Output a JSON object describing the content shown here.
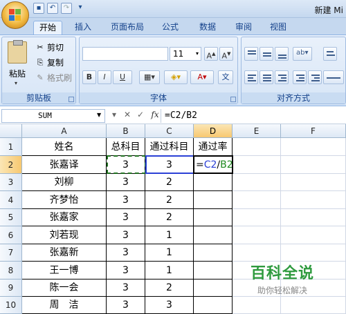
{
  "window": {
    "title": "新建 Mi"
  },
  "quick_access": [
    "save-icon",
    "undo-icon",
    "redo-icon",
    "customize-icon"
  ],
  "tabs": [
    "开始",
    "插入",
    "页面布局",
    "公式",
    "数据",
    "审阅",
    "视图"
  ],
  "ribbon": {
    "clipboard": {
      "label": "剪贴板",
      "paste": "粘贴",
      "cut": "剪切",
      "copy": "复制",
      "format_painter": "格式刷"
    },
    "font": {
      "label": "字体",
      "font_name": "",
      "font_size": "11",
      "bold": "B",
      "italic": "I",
      "underline": "U"
    },
    "alignment": {
      "label": "对齐方式"
    }
  },
  "formula_bar": {
    "name_box": "SUM",
    "fx": "fx",
    "cancel": "✕",
    "enter": "✓",
    "formula": "=C2/B2"
  },
  "sheet": {
    "columns": [
      "A",
      "B",
      "C",
      "D",
      "E",
      "F"
    ],
    "rows": [
      "1",
      "2",
      "3",
      "4",
      "5",
      "6",
      "7",
      "8",
      "9",
      "10"
    ],
    "header": [
      "姓名",
      "总科目",
      "通过科目",
      "通过率"
    ],
    "data": [
      {
        "name": "张嘉译",
        "total": "3",
        "passed": "3",
        "rate": "=C2/B2"
      },
      {
        "name": "刘柳",
        "total": "3",
        "passed": "2",
        "rate": ""
      },
      {
        "name": "齐梦怡",
        "total": "3",
        "passed": "2",
        "rate": ""
      },
      {
        "name": "张嘉家",
        "total": "3",
        "passed": "2",
        "rate": ""
      },
      {
        "name": "刘若现",
        "total": "3",
        "passed": "1",
        "rate": ""
      },
      {
        "name": "张嘉新",
        "total": "3",
        "passed": "1",
        "rate": ""
      },
      {
        "name": "王一博",
        "total": "3",
        "passed": "1",
        "rate": ""
      },
      {
        "name": "陈一会",
        "total": "3",
        "passed": "2",
        "rate": ""
      },
      {
        "name": "周　洁",
        "total": "3",
        "passed": "3",
        "rate": ""
      }
    ],
    "edit_formula": {
      "eq": "=",
      "ref1": "C2",
      "slash": "/",
      "ref2": "B2"
    },
    "colors": {
      "ref_c2": "#2a3fd6",
      "ref_b2": "#1f8a1f"
    }
  },
  "watermark": {
    "title": "百科全说",
    "subtitle": "助你轻松解决"
  }
}
